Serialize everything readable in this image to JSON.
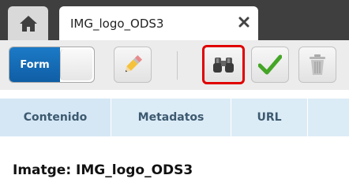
{
  "header": {
    "home_icon": "home-icon",
    "document_tab": {
      "title": "IMG_logo_ODS3",
      "close_icon": "close-icon"
    }
  },
  "toolbar": {
    "form_toggle": {
      "label": "Form",
      "state": "on"
    },
    "buttons": [
      {
        "name": "edit",
        "icon": "pencil-icon"
      },
      {
        "name": "search",
        "icon": "binoculars-icon",
        "highlighted": true
      },
      {
        "name": "accept",
        "icon": "checkmark-icon"
      },
      {
        "name": "delete",
        "icon": "trash-icon"
      }
    ],
    "highlight_color": "#e00000"
  },
  "subtabs": [
    {
      "label": "Contenido"
    },
    {
      "label": "Metadatos"
    },
    {
      "label": "URL"
    }
  ],
  "content": {
    "title": "Imatge: IMG_logo_ODS3"
  },
  "colors": {
    "tabstrip_bg": "#3f3f3f",
    "toggle_on": "#1c7ac6",
    "subtab_bg": "#dcecf7",
    "subtab_text": "#3d5a70"
  }
}
